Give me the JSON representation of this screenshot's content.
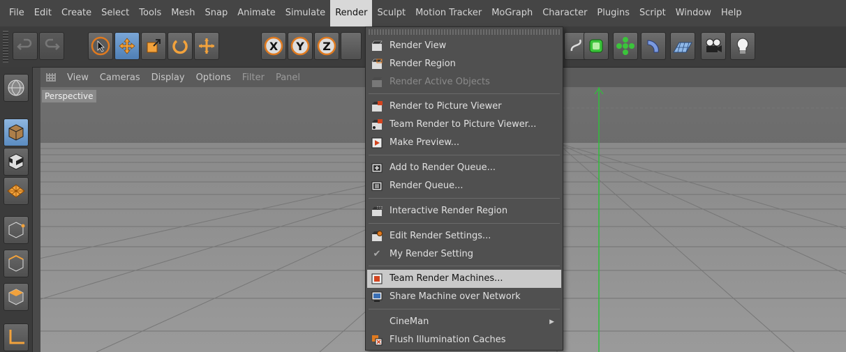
{
  "menubar": {
    "items": [
      "File",
      "Edit",
      "Create",
      "Select",
      "Tools",
      "Mesh",
      "Snap",
      "Animate",
      "Simulate",
      "Render",
      "Sculpt",
      "Motion Tracker",
      "MoGraph",
      "Character",
      "Plugins",
      "Script",
      "Window",
      "Help"
    ],
    "active": "Render"
  },
  "viewport": {
    "menu": [
      "View",
      "Cameras",
      "Display",
      "Options",
      "Filter",
      "Panel"
    ],
    "label": "Perspective"
  },
  "render_menu": {
    "items": [
      {
        "label": "Render View",
        "icon": "clapper-icon",
        "enabled": true
      },
      {
        "label": "Render Region",
        "icon": "clapper-region-icon",
        "enabled": true
      },
      {
        "label": "Render Active Objects",
        "icon": "clapper-objects-icon",
        "enabled": false
      },
      {
        "label": "Render to Picture Viewer",
        "icon": "picture-viewer-icon",
        "enabled": true
      },
      {
        "label": "Team Render to Picture Viewer...",
        "icon": "team-render-icon",
        "enabled": true
      },
      {
        "label": "Make Preview...",
        "icon": "preview-icon",
        "enabled": true
      },
      {
        "label": "Add to Render Queue...",
        "icon": "queue-add-icon",
        "enabled": true
      },
      {
        "label": "Render Queue...",
        "icon": "queue-icon",
        "enabled": true
      },
      {
        "label": "Interactive Render Region",
        "icon": "irr-icon",
        "enabled": true
      },
      {
        "label": "Edit Render Settings...",
        "icon": "settings-icon",
        "enabled": true
      },
      {
        "label": "My Render Setting",
        "icon": "check-icon",
        "enabled": true
      },
      {
        "label": "Team Render Machines...",
        "icon": "machines-icon",
        "enabled": true,
        "highlighted": true
      },
      {
        "label": "Share Machine over Network",
        "icon": "network-icon",
        "enabled": true
      },
      {
        "label": "CineMan",
        "icon": "",
        "enabled": true,
        "submenu": true
      },
      {
        "label": "Flush Illumination Caches",
        "icon": "flush-icon",
        "enabled": true
      }
    ]
  },
  "colors": {
    "accent_orange": "#e07a1f",
    "highlight": "#c9c9c9",
    "axis_green": "#2fbf3a"
  }
}
